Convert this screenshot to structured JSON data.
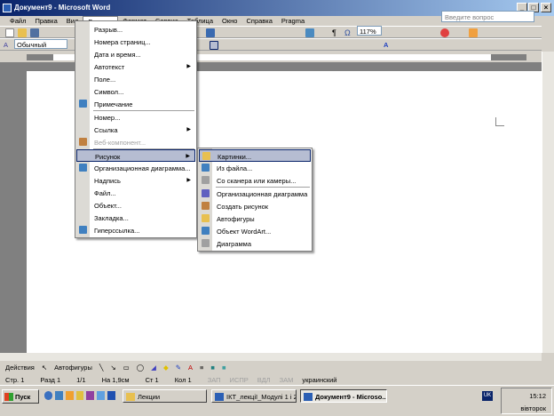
{
  "window": {
    "title": "Документ9 - Microsoft Word",
    "controls": [
      "_",
      "□",
      "×"
    ]
  },
  "menubar": [
    "Файл",
    "Правка",
    "Вид",
    "Вставка",
    "Формат",
    "Сервис",
    "Таблица",
    "Окно",
    "Справка",
    "Pragma"
  ],
  "ask_placeholder": "Введите вопрос",
  "toolbar": {
    "style": "Обычный",
    "zoom": "117%"
  },
  "insert_menu": [
    {
      "label": "Разрыв..."
    },
    {
      "label": "Номера страниц..."
    },
    {
      "label": "Дата и время..."
    },
    {
      "label": "Автотекст",
      "submenu": true
    },
    {
      "label": "Поле..."
    },
    {
      "label": "Символ..."
    },
    {
      "label": "Примечание",
      "icon": "comment-icon"
    },
    {
      "label": "Номер..."
    },
    {
      "label": "Ссылка",
      "submenu": true
    },
    {
      "label": "Веб-компонент...",
      "disabled": true,
      "icon": "web-component-icon"
    },
    {
      "label": "Рисунок",
      "submenu": true,
      "highlighted": true
    },
    {
      "label": "Организационная диаграмма...",
      "icon": "org-chart-icon"
    },
    {
      "label": "Надпись",
      "submenu": true
    },
    {
      "label": "Файл..."
    },
    {
      "label": "Объект..."
    },
    {
      "label": "Закладка..."
    },
    {
      "label": "Гиперссылка...",
      "icon": "hyperlink-icon"
    }
  ],
  "picture_submenu": [
    {
      "label": "Картинки...",
      "icon": "clipart-icon",
      "highlighted": true
    },
    {
      "label": "Из файла...",
      "icon": "from-file-icon"
    },
    {
      "label": "Со сканера или камеры...",
      "icon": "scanner-icon"
    },
    {
      "label": "Организационная диаграмма",
      "icon": "org-chart-icon"
    },
    {
      "label": "Создать рисунок",
      "icon": "new-drawing-icon"
    },
    {
      "label": "Автофигуры",
      "icon": "autoshapes-icon"
    },
    {
      "label": "Объект WordArt...",
      "icon": "wordart-icon"
    },
    {
      "label": "Диаграмма",
      "icon": "chart-icon"
    }
  ],
  "drawing": {
    "actions": "Действия",
    "autoshapes": "Автофигуры"
  },
  "status": {
    "page": "Стр. 1",
    "section": "Разд 1",
    "pages": "1/1",
    "at": "На 1,9см",
    "line": "Ст 1",
    "col": "Кол 1",
    "rec": "ЗАП",
    "trk": "ИСПР",
    "ext": "ВДЛ",
    "ovr": "ЗАМ",
    "lang": "украинский"
  },
  "taskbar": {
    "start": "Пуск",
    "tasks": [
      "Лекции",
      "ІКТ_лекції_Модулі 1 і 2....",
      "Документ9 - Microso..."
    ],
    "lang": "UK",
    "time": "15:12",
    "day": "вівторок"
  },
  "colors": {
    "title": "#0a246a",
    "highlight": "#b6bdd2"
  }
}
